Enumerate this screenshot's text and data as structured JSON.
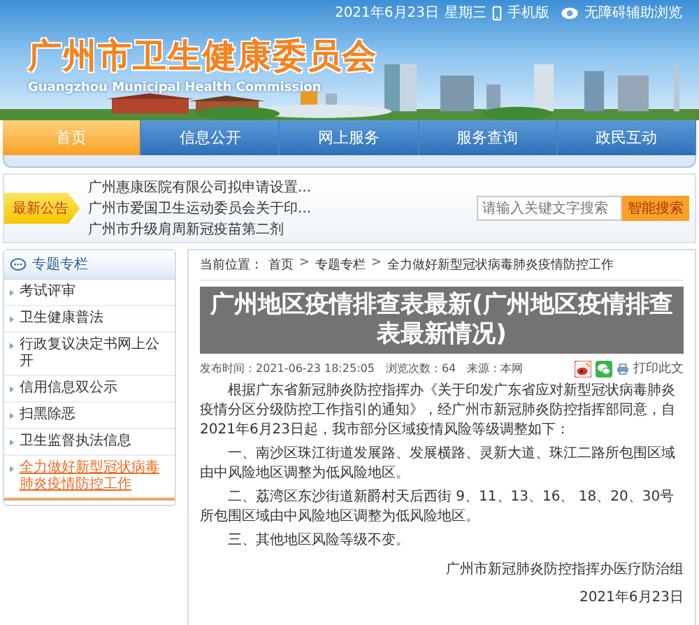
{
  "header": {
    "title": "广州市卫生健康委员会",
    "subtitle": "Guangzhou Municipal Health Commission",
    "date": "2021年6月23日",
    "weekday": "星期三",
    "links": [
      {
        "kind": "mobile",
        "label": "手机版"
      },
      {
        "kind": "accessibility",
        "label": "无障碍辅助浏览"
      }
    ]
  },
  "nav": {
    "tabs": [
      {
        "label": "首页",
        "selected": true
      },
      {
        "label": "信息公开",
        "selected": false
      },
      {
        "label": "网上服务",
        "selected": false
      },
      {
        "label": "服务查询",
        "selected": false
      },
      {
        "label": "政民互动",
        "selected": false
      }
    ]
  },
  "notice": {
    "label": "最新公告",
    "items": [
      "广州惠康医院有限公司拟申请设置...",
      "广州市爱国卫生运动委员会关于印...",
      "广州市升级肩周新冠疫苗第二剂"
    ],
    "search": {
      "placeholder": "请输入关键文字搜索"
    },
    "search_button": "智能搜索"
  },
  "sidebar": {
    "title": "专题专栏",
    "items": [
      {
        "label": "考试评审",
        "selected": false
      },
      {
        "label": "卫生健康普法",
        "selected": false
      },
      {
        "label": "行政复议决定书网上公开",
        "selected": false
      },
      {
        "label": "信用信息双公示",
        "selected": false
      },
      {
        "label": "扫黑除恶",
        "selected": false
      },
      {
        "label": "卫生监督执法信息",
        "selected": false
      },
      {
        "label": "全力做好新型冠状病毒肺炎疫情防控工作",
        "selected": true
      }
    ]
  },
  "article": {
    "breadcrumb": [
      {
        "kind": "label",
        "text": "当前位置："
      },
      {
        "kind": "link",
        "text": "首页"
      },
      {
        "kind": "sep",
        "text": ">"
      },
      {
        "kind": "link",
        "text": "专题专栏"
      },
      {
        "kind": "sep",
        "text": ">"
      },
      {
        "kind": "link",
        "text": "全力做好新型冠状病毒肺炎疫情防控工作"
      }
    ],
    "overlay_title": "广州地区疫情排查表最新(广州地区疫情排查表最新情况)",
    "meta": "发布时间：2021-06-23 18:25:05　浏览次数：64　来源：本网",
    "print": "打印此文",
    "paragraphs": [
      "根据广东省新冠肺炎防控指挥办《关于印发广东省应对新型冠状病毒肺炎疫情分区分级防控工作指引的通知》，经广州市新冠肺炎防控指挥部同意，自2021年6月23日起，我市部分区域疫情风险等级调整如下：",
      "一、南沙区珠江街道发展路、发展横路、灵新大道、珠江二路所包围区域由中风险地区调整为低风险地区。",
      "二、荔湾区东沙街道新爵村天后西街 9、11、13、16、 18、20、30号所包围区域由中风险地区调整为低风险地区。",
      "三、其他地区风险等级不变。"
    ],
    "signature": "广州市新冠肺炎防控指挥办医疗防治组",
    "date": "2021年6月23日"
  }
}
